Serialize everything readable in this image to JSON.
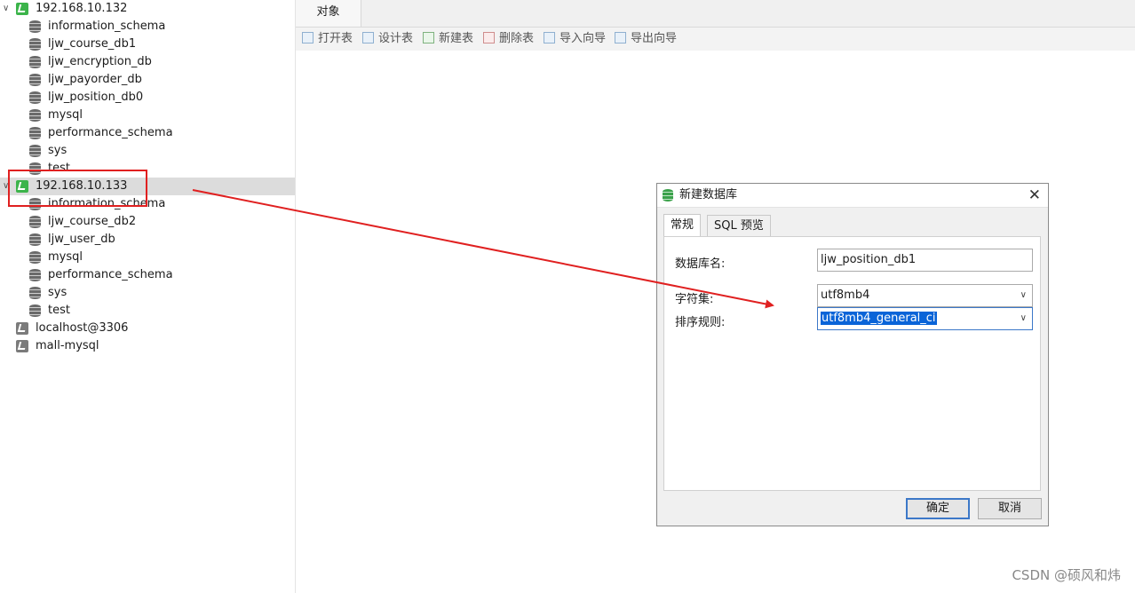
{
  "tree": {
    "connections": [
      {
        "name": "192.168.10.132",
        "expanded": true,
        "status": "connected",
        "databases": [
          "information_schema",
          "ljw_course_db1",
          "ljw_encryption_db",
          "ljw_payorder_db",
          "ljw_position_db0",
          "mysql",
          "performance_schema",
          "sys",
          "test"
        ]
      },
      {
        "name": "192.168.10.133",
        "expanded": true,
        "status": "connected",
        "selected": true,
        "databases": [
          "information_schema",
          "ljw_course_db2",
          "ljw_user_db",
          "mysql",
          "performance_schema",
          "sys",
          "test"
        ]
      },
      {
        "name": "localhost@3306",
        "expanded": false,
        "status": "disconnected",
        "databases": []
      },
      {
        "name": "mall-mysql",
        "expanded": false,
        "status": "disconnected",
        "databases": []
      }
    ]
  },
  "tabs": {
    "object_tab": "对象"
  },
  "toolbar": {
    "open_table": "打开表",
    "design_table": "设计表",
    "new_table": "新建表",
    "delete_table": "删除表",
    "import_wizard": "导入向导",
    "export_wizard": "导出向导"
  },
  "dialog": {
    "title": "新建数据库",
    "tab_general": "常规",
    "tab_sql_preview": "SQL 预览",
    "db_name_label": "数据库名:",
    "db_name_value": "ljw_position_db1",
    "charset_label": "字符集:",
    "charset_value": "utf8mb4",
    "collation_label": "排序规则:",
    "collation_value": "utf8mb4_general_ci",
    "ok_button": "确定",
    "cancel_button": "取消"
  },
  "annotation": {
    "color": "#e02020"
  },
  "watermark": "CSDN @硕风和炜",
  "colors": {
    "connected": "#3cb44b",
    "disconnected": "#7b7b7b",
    "selection": "#dcdcdc",
    "accent": "#3c78c8"
  }
}
